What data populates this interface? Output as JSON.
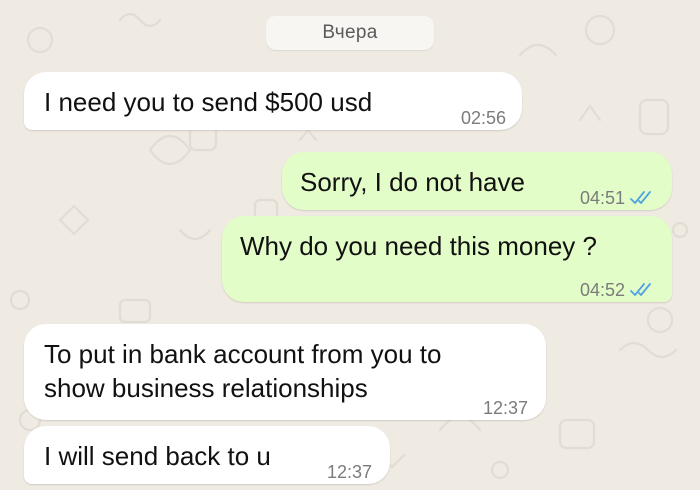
{
  "chat": {
    "date_separator": "Вчера",
    "messages": [
      {
        "direction": "incoming",
        "lines": [
          "I need you to send $500 usd"
        ],
        "time": "02:56"
      },
      {
        "direction": "outgoing",
        "lines": [
          "Sorry, I do not have"
        ],
        "time": "04:51",
        "status_icon": "double-check-read-icon"
      },
      {
        "direction": "outgoing",
        "lines": [
          "Why do you need this money ?"
        ],
        "time": "04:52",
        "status_icon": "double-check-read-icon"
      },
      {
        "direction": "incoming",
        "lines": [
          "To put in bank account from you to",
          "show business relationships"
        ],
        "time": "12:37"
      },
      {
        "direction": "incoming",
        "lines": [
          "I will send back to u"
        ],
        "time": "12:37"
      }
    ]
  },
  "theme": {
    "wallpaper": "#efeae2",
    "incoming_bubble": "#ffffff",
    "outgoing_bubble": "#e3fdc9",
    "read_check": "#4fa3e0"
  }
}
